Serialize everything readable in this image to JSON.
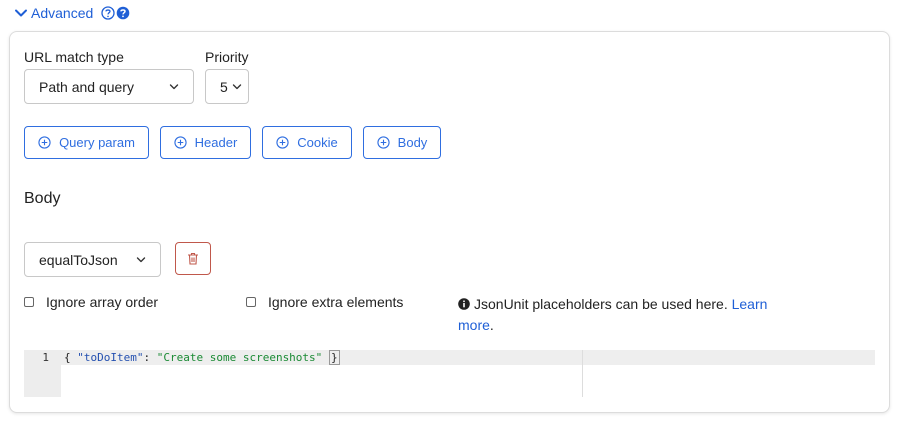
{
  "advanced": {
    "label": "Advanced",
    "icons": [
      "chevron-down-icon",
      "question-circle-outline-icon",
      "question-circle-filled-icon"
    ],
    "accent_color": "#1f5fd6"
  },
  "url_match": {
    "label": "URL match type",
    "selected": "Path and query"
  },
  "priority": {
    "label": "Priority",
    "selected": "5"
  },
  "add_buttons": [
    {
      "label": "Query param",
      "icon": "plus-circle-icon"
    },
    {
      "label": "Header",
      "icon": "plus-circle-icon"
    },
    {
      "label": "Cookie",
      "icon": "plus-circle-icon"
    },
    {
      "label": "Body",
      "icon": "plus-circle-icon"
    }
  ],
  "body_section": {
    "title": "Body",
    "matcher_selected": "equalToJson",
    "delete_icon": "trash-icon",
    "delete_color": "#c0584b",
    "options": [
      {
        "label": "Ignore array order",
        "checked": false
      },
      {
        "label": "Ignore extra elements",
        "checked": false
      }
    ],
    "note": {
      "icon": "info-circle-icon",
      "text": "JsonUnit placeholders can be used here.",
      "link_text": "Learn more",
      "link_suffix": "."
    }
  },
  "editor": {
    "line_number": "1",
    "open_brace": "{ ",
    "key": "\"toDoItem\"",
    "colon": ": ",
    "value": "\"Create some screenshots\"",
    "close_brace": "}"
  }
}
